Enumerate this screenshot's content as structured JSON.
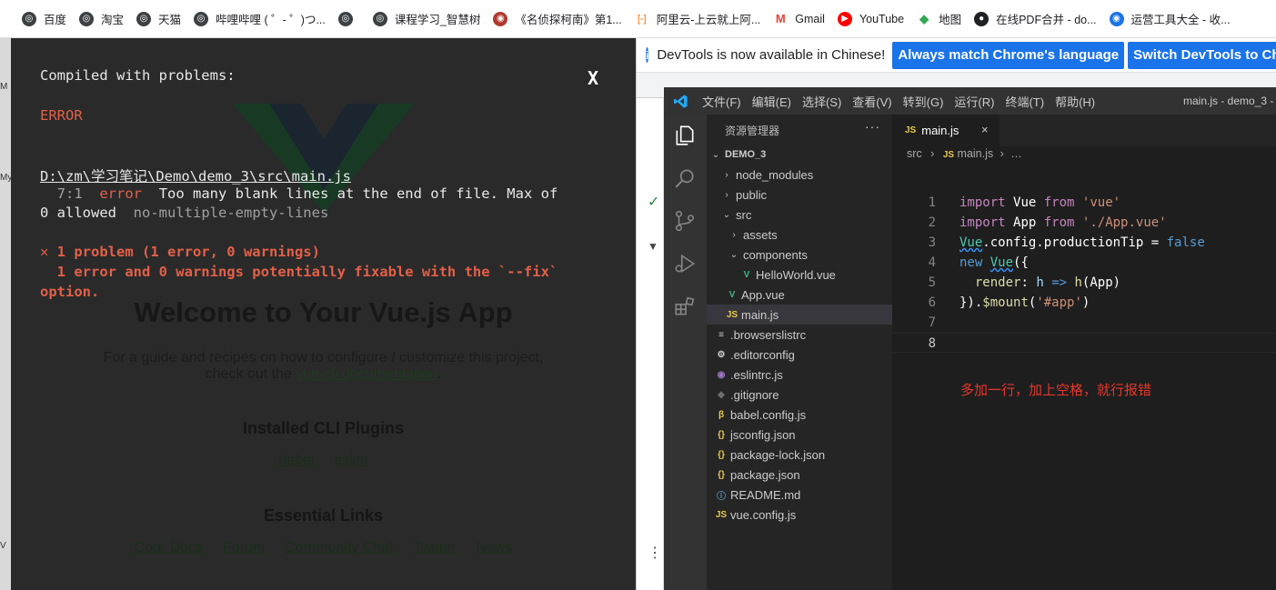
{
  "bookmarks": [
    {
      "label": "百度",
      "icon": "globe-icon"
    },
    {
      "label": "淘宝",
      "icon": "globe-icon"
    },
    {
      "label": "天猫",
      "icon": "globe-icon"
    },
    {
      "label": "哔哩哔哩 ( ゜- ゜)つ...",
      "icon": "globe-icon"
    },
    {
      "label": "",
      "icon": "globe-icon"
    },
    {
      "label": "课程学习_智慧树",
      "icon": "globe-icon"
    },
    {
      "label": "《名侦探柯南》第1...",
      "icon": "circle-logo-icon"
    },
    {
      "label": "阿里云-上云就上阿...",
      "icon": "aliyun-icon"
    },
    {
      "label": "Gmail",
      "icon": "gmail-icon"
    },
    {
      "label": "YouTube",
      "icon": "youtube-icon"
    },
    {
      "label": "地图",
      "icon": "maps-icon"
    },
    {
      "label": "在线PDF合并 - do...",
      "icon": "pdf-icon"
    },
    {
      "label": "运营工具大全 - 收...",
      "icon": "circle-blue-icon"
    }
  ],
  "overlay": {
    "heading": "Compiled with problems:",
    "close_label": "X",
    "error_label": "ERROR",
    "file_path": "D:\\zm\\学习笔记\\Demo\\demo_3\\src\\main.js",
    "location": "7:1",
    "severity": "error",
    "message_line1": "Too many blank lines at the end of file. Max of",
    "message_line2": "0 allowed",
    "rule": "no-multiple-empty-lines",
    "summary_line1": "✕ 1 problem (1 error, 0 warnings)",
    "summary_line2": "  1 error and 0 warnings potentially fixable with the `--fix`",
    "summary_line3": "option."
  },
  "page_behind": {
    "title": "Welcome to Your Vue.js App",
    "desc_line1": "For a guide and recipes on how to configure / customize this project,",
    "desc_line2_prefix": "check out the ",
    "desc_link": "vue-cli documentation",
    "desc_line2_suffix": ".",
    "plugins_heading": "Installed CLI Plugins",
    "plugins": [
      "babel",
      "eslint"
    ],
    "links_heading": "Essential Links",
    "links": [
      "Core Docs",
      "Forum",
      "Community Chat",
      "Twitter",
      "News"
    ]
  },
  "devtools": {
    "banner_message": "DevTools is now available in Chinese!",
    "btn_match": "Always match Chrome's language",
    "btn_switch": "Switch DevTools to Chinese"
  },
  "vscode": {
    "menu": [
      "文件(F)",
      "编辑(E)",
      "选择(S)",
      "查看(V)",
      "转到(G)",
      "运行(R)",
      "终端(T)",
      "帮助(H)"
    ],
    "window_title": "main.js - demo_3 -",
    "explorer_title": "资源管理器",
    "explorer_more": "···",
    "tree": [
      {
        "label": "DEMO_3",
        "chev": "⌄",
        "icon": "",
        "color": "",
        "root": true
      },
      {
        "label": "node_modules",
        "chev": "›",
        "icon": "",
        "color": ""
      },
      {
        "label": "public",
        "chev": "›",
        "icon": "",
        "color": ""
      },
      {
        "label": "src",
        "chev": "⌄",
        "icon": "",
        "color": ""
      },
      {
        "label": "assets",
        "chev": "›",
        "icon": "",
        "color": ""
      },
      {
        "label": "components",
        "chev": "⌄",
        "icon": "",
        "color": ""
      },
      {
        "label": "HelloWorld.vue",
        "chev": "",
        "icon": "V",
        "color": "#41b883"
      },
      {
        "label": "App.vue",
        "chev": "",
        "icon": "V",
        "color": "#41b883"
      },
      {
        "label": "main.js",
        "chev": "",
        "icon": "JS",
        "color": "#e8c94a",
        "selected": true
      },
      {
        "label": ".browserslistrc",
        "chev": "",
        "icon": "≡",
        "color": "#cccccc"
      },
      {
        "label": ".editorconfig",
        "chev": "",
        "icon": "⚙",
        "color": "#cccccc"
      },
      {
        "label": ".eslintrc.js",
        "chev": "",
        "icon": "◉",
        "color": "#a074c4"
      },
      {
        "label": ".gitignore",
        "chev": "",
        "icon": "◆",
        "color": "#6d6d6d"
      },
      {
        "label": "babel.config.js",
        "chev": "",
        "icon": "β",
        "color": "#e8c94a"
      },
      {
        "label": "jsconfig.json",
        "chev": "",
        "icon": "{}",
        "color": "#e8c94a"
      },
      {
        "label": "package-lock.json",
        "chev": "",
        "icon": "{}",
        "color": "#e8c94a"
      },
      {
        "label": "package.json",
        "chev": "",
        "icon": "{}",
        "color": "#e8c94a"
      },
      {
        "label": "README.md",
        "chev": "",
        "icon": "ⓘ",
        "color": "#519aba"
      },
      {
        "label": "vue.config.js",
        "chev": "",
        "icon": "JS",
        "color": "#e8c94a"
      }
    ],
    "tab_label": "main.js",
    "tab_close": "×",
    "breadcrumb_src": "src",
    "breadcrumb_file": "main.js",
    "breadcrumb_rest": "…",
    "line_numbers": [
      "1",
      "2",
      "3",
      "4",
      "5",
      "6",
      "7",
      "8"
    ],
    "annotation": "多加一行，加上空格，就行报错"
  }
}
